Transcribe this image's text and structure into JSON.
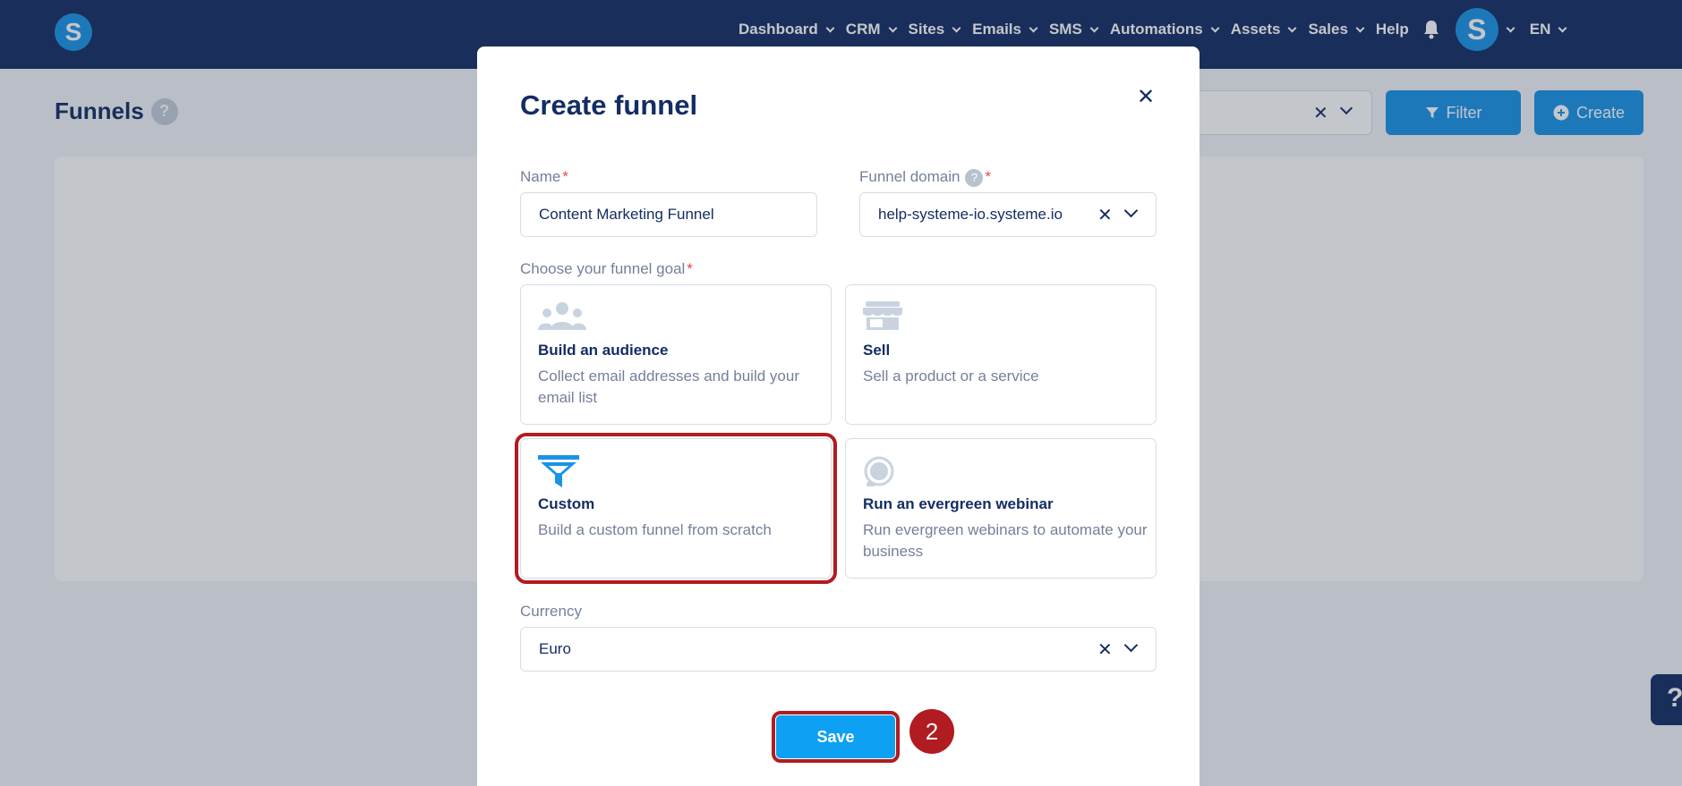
{
  "nav": {
    "items": [
      {
        "label": "Dashboard"
      },
      {
        "label": "CRM"
      },
      {
        "label": "Sites"
      },
      {
        "label": "Emails"
      },
      {
        "label": "SMS"
      },
      {
        "label": "Automations"
      },
      {
        "label": "Assets"
      },
      {
        "label": "Sales"
      }
    ],
    "help_label": "Help",
    "logo_letter": "S",
    "avatar_letter": "S",
    "language": "EN"
  },
  "page": {
    "title": "Funnels",
    "help_mark": "?",
    "filter_label": "Filter",
    "create_label": "Create",
    "help_tab": "?"
  },
  "modal": {
    "title": "Create funnel",
    "close_glyph": "✕",
    "name_label": "Name",
    "name_value": "Content Marketing Funnel",
    "domain_label": "Funnel domain",
    "domain_value": "help-systeme-io.systeme.io",
    "goal_label": "Choose your funnel goal",
    "required_mark": "*",
    "help_mark": "?",
    "clear_glyph": "✕",
    "goals": [
      {
        "title": "Build an audience",
        "description": "Collect email addresses and build your email list",
        "icon": "audience-icon"
      },
      {
        "title": "Sell",
        "description": "Sell a product or a service",
        "icon": "store-icon"
      },
      {
        "title": "Custom",
        "description": "Build a custom funnel from scratch",
        "icon": "funnel-icon",
        "selected": true
      },
      {
        "title": "Run an evergreen webinar",
        "description": "Run evergreen webinars to automate your business",
        "icon": "webinar-icon"
      }
    ],
    "currency_label": "Currency",
    "currency_value": "Euro",
    "save_label": "Save",
    "step_number": "2"
  },
  "colors": {
    "nav_bg": "#142d63",
    "accent": "#1a93e8",
    "highlight": "#b01c21"
  }
}
